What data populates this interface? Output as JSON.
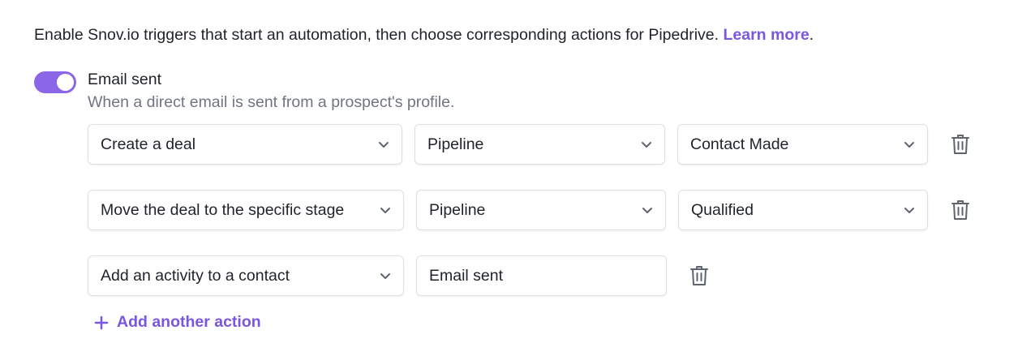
{
  "intro": {
    "text": "Enable Snov.io triggers that start an automation, then choose corresponding actions for Pipedrive. ",
    "link": "Learn more",
    "suffix": "."
  },
  "trigger": {
    "enabled": true,
    "title": "Email sent",
    "description": "When a direct email is sent from a prospect's profile."
  },
  "actions": [
    {
      "action": "Create a deal",
      "pipeline": "Pipeline",
      "stage": "Contact Made"
    },
    {
      "action": "Move the deal to the specific stage",
      "pipeline": "Pipeline",
      "stage": "Qualified"
    },
    {
      "action": "Add an activity to a contact",
      "activity": "Email sent"
    }
  ],
  "add_action_label": "Add another action",
  "icons": {
    "dropdown": "chevron-down-icon",
    "delete": "trash-icon",
    "add": "plus-icon"
  },
  "colors": {
    "accent": "#7a57e0",
    "toggle_on": "#8b66e6",
    "muted_text": "#6f7582",
    "icon": "#5d6470"
  }
}
